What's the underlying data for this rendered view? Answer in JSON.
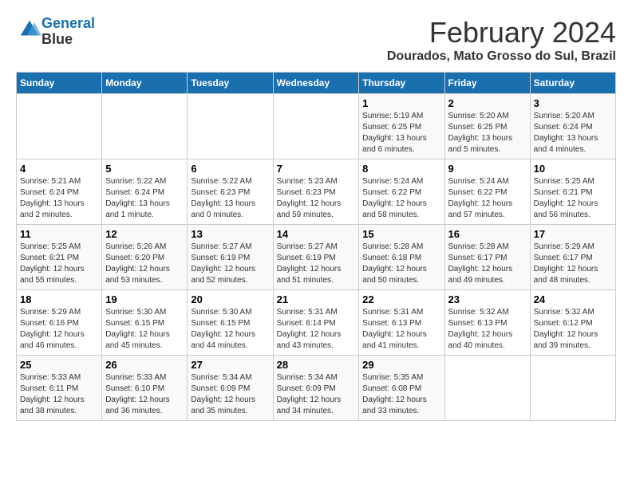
{
  "logo": {
    "line1": "General",
    "line2": "Blue"
  },
  "title": "February 2024",
  "location": "Dourados, Mato Grosso do Sul, Brazil",
  "days_of_week": [
    "Sunday",
    "Monday",
    "Tuesday",
    "Wednesday",
    "Thursday",
    "Friday",
    "Saturday"
  ],
  "weeks": [
    [
      {
        "day": "",
        "info": ""
      },
      {
        "day": "",
        "info": ""
      },
      {
        "day": "",
        "info": ""
      },
      {
        "day": "",
        "info": ""
      },
      {
        "day": "1",
        "info": "Sunrise: 5:19 AM\nSunset: 6:25 PM\nDaylight: 13 hours\nand 6 minutes."
      },
      {
        "day": "2",
        "info": "Sunrise: 5:20 AM\nSunset: 6:25 PM\nDaylight: 13 hours\nand 5 minutes."
      },
      {
        "day": "3",
        "info": "Sunrise: 5:20 AM\nSunset: 6:24 PM\nDaylight: 13 hours\nand 4 minutes."
      }
    ],
    [
      {
        "day": "4",
        "info": "Sunrise: 5:21 AM\nSunset: 6:24 PM\nDaylight: 13 hours\nand 2 minutes."
      },
      {
        "day": "5",
        "info": "Sunrise: 5:22 AM\nSunset: 6:24 PM\nDaylight: 13 hours\nand 1 minute."
      },
      {
        "day": "6",
        "info": "Sunrise: 5:22 AM\nSunset: 6:23 PM\nDaylight: 13 hours\nand 0 minutes."
      },
      {
        "day": "7",
        "info": "Sunrise: 5:23 AM\nSunset: 6:23 PM\nDaylight: 12 hours\nand 59 minutes."
      },
      {
        "day": "8",
        "info": "Sunrise: 5:24 AM\nSunset: 6:22 PM\nDaylight: 12 hours\nand 58 minutes."
      },
      {
        "day": "9",
        "info": "Sunrise: 5:24 AM\nSunset: 6:22 PM\nDaylight: 12 hours\nand 57 minutes."
      },
      {
        "day": "10",
        "info": "Sunrise: 5:25 AM\nSunset: 6:21 PM\nDaylight: 12 hours\nand 56 minutes."
      }
    ],
    [
      {
        "day": "11",
        "info": "Sunrise: 5:25 AM\nSunset: 6:21 PM\nDaylight: 12 hours\nand 55 minutes."
      },
      {
        "day": "12",
        "info": "Sunrise: 5:26 AM\nSunset: 6:20 PM\nDaylight: 12 hours\nand 53 minutes."
      },
      {
        "day": "13",
        "info": "Sunrise: 5:27 AM\nSunset: 6:19 PM\nDaylight: 12 hours\nand 52 minutes."
      },
      {
        "day": "14",
        "info": "Sunrise: 5:27 AM\nSunset: 6:19 PM\nDaylight: 12 hours\nand 51 minutes."
      },
      {
        "day": "15",
        "info": "Sunrise: 5:28 AM\nSunset: 6:18 PM\nDaylight: 12 hours\nand 50 minutes."
      },
      {
        "day": "16",
        "info": "Sunrise: 5:28 AM\nSunset: 6:17 PM\nDaylight: 12 hours\nand 49 minutes."
      },
      {
        "day": "17",
        "info": "Sunrise: 5:29 AM\nSunset: 6:17 PM\nDaylight: 12 hours\nand 48 minutes."
      }
    ],
    [
      {
        "day": "18",
        "info": "Sunrise: 5:29 AM\nSunset: 6:16 PM\nDaylight: 12 hours\nand 46 minutes."
      },
      {
        "day": "19",
        "info": "Sunrise: 5:30 AM\nSunset: 6:15 PM\nDaylight: 12 hours\nand 45 minutes."
      },
      {
        "day": "20",
        "info": "Sunrise: 5:30 AM\nSunset: 6:15 PM\nDaylight: 12 hours\nand 44 minutes."
      },
      {
        "day": "21",
        "info": "Sunrise: 5:31 AM\nSunset: 6:14 PM\nDaylight: 12 hours\nand 43 minutes."
      },
      {
        "day": "22",
        "info": "Sunrise: 5:31 AM\nSunset: 6:13 PM\nDaylight: 12 hours\nand 41 minutes."
      },
      {
        "day": "23",
        "info": "Sunrise: 5:32 AM\nSunset: 6:13 PM\nDaylight: 12 hours\nand 40 minutes."
      },
      {
        "day": "24",
        "info": "Sunrise: 5:32 AM\nSunset: 6:12 PM\nDaylight: 12 hours\nand 39 minutes."
      }
    ],
    [
      {
        "day": "25",
        "info": "Sunrise: 5:33 AM\nSunset: 6:11 PM\nDaylight: 12 hours\nand 38 minutes."
      },
      {
        "day": "26",
        "info": "Sunrise: 5:33 AM\nSunset: 6:10 PM\nDaylight: 12 hours\nand 36 minutes."
      },
      {
        "day": "27",
        "info": "Sunrise: 5:34 AM\nSunset: 6:09 PM\nDaylight: 12 hours\nand 35 minutes."
      },
      {
        "day": "28",
        "info": "Sunrise: 5:34 AM\nSunset: 6:09 PM\nDaylight: 12 hours\nand 34 minutes."
      },
      {
        "day": "29",
        "info": "Sunrise: 5:35 AM\nSunset: 6:08 PM\nDaylight: 12 hours\nand 33 minutes."
      },
      {
        "day": "",
        "info": ""
      },
      {
        "day": "",
        "info": ""
      }
    ]
  ]
}
